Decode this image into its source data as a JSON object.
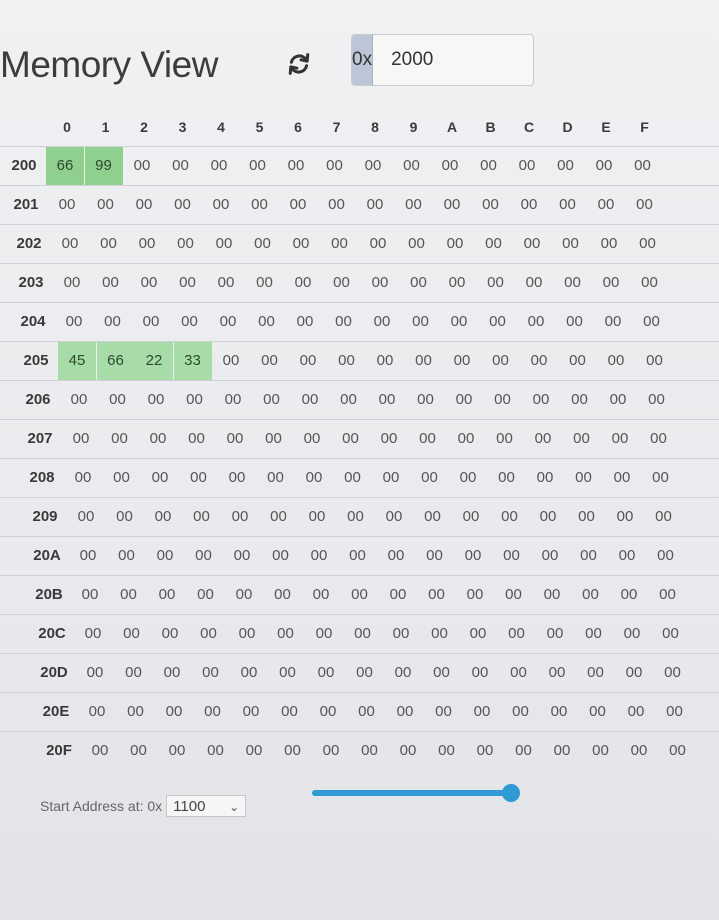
{
  "header": {
    "title": "Memory View",
    "address_prefix": "0x",
    "address_value": "2000"
  },
  "columns": [
    "0",
    "1",
    "2",
    "3",
    "4",
    "5",
    "6",
    "7",
    "8",
    "9",
    "A",
    "B",
    "C",
    "D",
    "E",
    "F"
  ],
  "rows": [
    {
      "label": "200",
      "cells": [
        "66",
        "99",
        "00",
        "00",
        "00",
        "00",
        "00",
        "00",
        "00",
        "00",
        "00",
        "00",
        "00",
        "00",
        "00",
        "00"
      ],
      "highlight": [
        0,
        1
      ]
    },
    {
      "label": "201",
      "cells": [
        "00",
        "00",
        "00",
        "00",
        "00",
        "00",
        "00",
        "00",
        "00",
        "00",
        "00",
        "00",
        "00",
        "00",
        "00",
        "00"
      ],
      "highlight": []
    },
    {
      "label": "202",
      "cells": [
        "00",
        "00",
        "00",
        "00",
        "00",
        "00",
        "00",
        "00",
        "00",
        "00",
        "00",
        "00",
        "00",
        "00",
        "00",
        "00"
      ],
      "highlight": []
    },
    {
      "label": "203",
      "cells": [
        "00",
        "00",
        "00",
        "00",
        "00",
        "00",
        "00",
        "00",
        "00",
        "00",
        "00",
        "00",
        "00",
        "00",
        "00",
        "00"
      ],
      "highlight": []
    },
    {
      "label": "204",
      "cells": [
        "00",
        "00",
        "00",
        "00",
        "00",
        "00",
        "00",
        "00",
        "00",
        "00",
        "00",
        "00",
        "00",
        "00",
        "00",
        "00"
      ],
      "highlight": []
    },
    {
      "label": "205",
      "cells": [
        "45",
        "66",
        "22",
        "33",
        "00",
        "00",
        "00",
        "00",
        "00",
        "00",
        "00",
        "00",
        "00",
        "00",
        "00",
        "00"
      ],
      "highlight": [
        0,
        1,
        2,
        3
      ]
    },
    {
      "label": "206",
      "cells": [
        "00",
        "00",
        "00",
        "00",
        "00",
        "00",
        "00",
        "00",
        "00",
        "00",
        "00",
        "00",
        "00",
        "00",
        "00",
        "00"
      ],
      "highlight": []
    },
    {
      "label": "207",
      "cells": [
        "00",
        "00",
        "00",
        "00",
        "00",
        "00",
        "00",
        "00",
        "00",
        "00",
        "00",
        "00",
        "00",
        "00",
        "00",
        "00"
      ],
      "highlight": []
    },
    {
      "label": "208",
      "cells": [
        "00",
        "00",
        "00",
        "00",
        "00",
        "00",
        "00",
        "00",
        "00",
        "00",
        "00",
        "00",
        "00",
        "00",
        "00",
        "00"
      ],
      "highlight": []
    },
    {
      "label": "209",
      "cells": [
        "00",
        "00",
        "00",
        "00",
        "00",
        "00",
        "00",
        "00",
        "00",
        "00",
        "00",
        "00",
        "00",
        "00",
        "00",
        "00"
      ],
      "highlight": []
    },
    {
      "label": "20A",
      "cells": [
        "00",
        "00",
        "00",
        "00",
        "00",
        "00",
        "00",
        "00",
        "00",
        "00",
        "00",
        "00",
        "00",
        "00",
        "00",
        "00"
      ],
      "highlight": []
    },
    {
      "label": "20B",
      "cells": [
        "00",
        "00",
        "00",
        "00",
        "00",
        "00",
        "00",
        "00",
        "00",
        "00",
        "00",
        "00",
        "00",
        "00",
        "00",
        "00"
      ],
      "highlight": []
    },
    {
      "label": "20C",
      "cells": [
        "00",
        "00",
        "00",
        "00",
        "00",
        "00",
        "00",
        "00",
        "00",
        "00",
        "00",
        "00",
        "00",
        "00",
        "00",
        "00"
      ],
      "highlight": []
    },
    {
      "label": "20D",
      "cells": [
        "00",
        "00",
        "00",
        "00",
        "00",
        "00",
        "00",
        "00",
        "00",
        "00",
        "00",
        "00",
        "00",
        "00",
        "00",
        "00"
      ],
      "highlight": []
    },
    {
      "label": "20E",
      "cells": [
        "00",
        "00",
        "00",
        "00",
        "00",
        "00",
        "00",
        "00",
        "00",
        "00",
        "00",
        "00",
        "00",
        "00",
        "00",
        "00"
      ],
      "highlight": []
    },
    {
      "label": "20F",
      "cells": [
        "00",
        "00",
        "00",
        "00",
        "00",
        "00",
        "00",
        "00",
        "00",
        "00",
        "00",
        "00",
        "00",
        "00",
        "00",
        "00"
      ],
      "highlight": []
    }
  ],
  "footer": {
    "start_label": "Start Address at: 0x",
    "start_value": "1100",
    "slider_value_fraction": 1.0
  },
  "colors": {
    "highlight": "#8fd08f",
    "accent": "#2f9ad3",
    "prefix_bg": "#bcc6d6"
  },
  "icons": {
    "refresh": "refresh-icon",
    "dropdown": "chevron-down-icon"
  }
}
